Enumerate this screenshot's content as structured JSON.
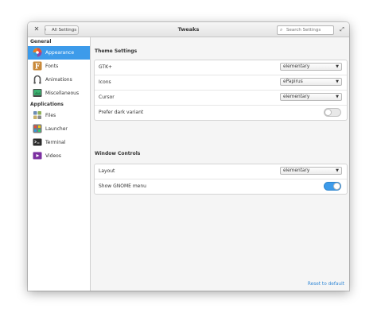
{
  "window": {
    "title": "Tweaks",
    "back_label": "All Settings",
    "search_placeholder": "Search Settings"
  },
  "sidebar": {
    "groups": [
      {
        "header": "General",
        "items": [
          {
            "label": "Appearance",
            "icon": "appearance-icon",
            "selected": true
          },
          {
            "label": "Fonts",
            "icon": "fonts-icon"
          },
          {
            "label": "Animations",
            "icon": "animations-icon"
          },
          {
            "label": "Miscellaneous",
            "icon": "miscellaneous-icon"
          }
        ]
      },
      {
        "header": "Applications",
        "items": [
          {
            "label": "Files",
            "icon": "files-icon"
          },
          {
            "label": "Launcher",
            "icon": "launcher-icon"
          },
          {
            "label": "Terminal",
            "icon": "terminal-icon"
          },
          {
            "label": "Videos",
            "icon": "videos-icon"
          }
        ]
      }
    ]
  },
  "theme_settings": {
    "title": "Theme Settings",
    "rows": [
      {
        "label": "GTK+",
        "value": "elementary"
      },
      {
        "label": "Icons",
        "value": "ePapirus"
      },
      {
        "label": "Cursor",
        "value": "elementary"
      },
      {
        "label": "Prefer dark variant",
        "toggle": false
      }
    ]
  },
  "window_controls": {
    "title": "Window Controls",
    "rows": [
      {
        "label": "Layout",
        "value": "elementary"
      },
      {
        "label": "Show GNOME menu",
        "toggle": true
      }
    ]
  },
  "reset_label": "Reset to default",
  "colors": {
    "accent": "#3d9bea",
    "link": "#3489d6"
  }
}
